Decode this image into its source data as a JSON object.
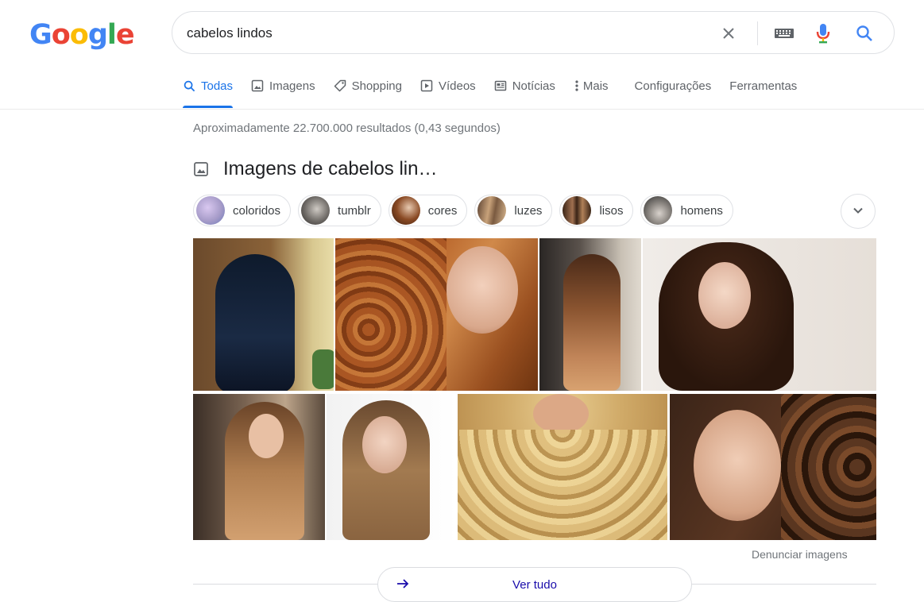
{
  "logo": {
    "letters": [
      "G",
      "o",
      "o",
      "g",
      "l",
      "e"
    ],
    "colors": [
      "#4285f4",
      "#ea4335",
      "#fbbc05",
      "#4285f4",
      "#34a853",
      "#ea4335"
    ]
  },
  "search": {
    "value": "cabelos lindos"
  },
  "icons": {
    "clear": "close-icon",
    "keyboard": "keyboard-icon",
    "voice": "microphone-icon",
    "search": "search-icon"
  },
  "tabs": [
    {
      "label": "Todas",
      "icon": "search-icon",
      "active": true
    },
    {
      "label": "Imagens",
      "icon": "image-icon",
      "active": false
    },
    {
      "label": "Shopping",
      "icon": "tag-icon",
      "active": false
    },
    {
      "label": "Vídeos",
      "icon": "play-icon",
      "active": false
    },
    {
      "label": "Notícias",
      "icon": "news-icon",
      "active": false
    },
    {
      "label": "Mais",
      "icon": "more-vertical-icon",
      "active": false
    },
    {
      "label": "Configurações",
      "active": false
    },
    {
      "label": "Ferramentas",
      "active": false
    }
  ],
  "results": {
    "stats": "Aproximadamente 22.700.000 resultados (0,43 segundos)"
  },
  "images_section": {
    "heading": "Imagens de cabelos lin…",
    "chips": [
      {
        "label": "coloridos",
        "color": "#a79cc9"
      },
      {
        "label": "tumblr",
        "color": "#6e6a66"
      },
      {
        "label": "cores",
        "color": "#8a4a24"
      },
      {
        "label": "luzes",
        "color": "#9c7a5a"
      },
      {
        "label": "lisos",
        "color": "#6a4a30"
      },
      {
        "label": "homens",
        "color": "#4a4a4a"
      }
    ],
    "report_label": "Denunciar imagens",
    "see_all_label": "Ver tudo",
    "accent": "#1a73e8",
    "link_color": "#1a0dab"
  }
}
